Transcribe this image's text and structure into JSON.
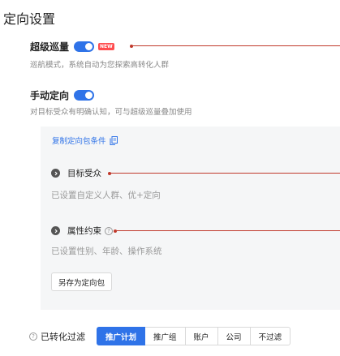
{
  "page": {
    "title": "定向设置"
  },
  "super_cruise": {
    "label": "超级巡量",
    "enabled": true,
    "badge": "NEW",
    "description": "巡航模式，系统自动为您探索高转化人群"
  },
  "manual_targeting": {
    "label": "手动定向",
    "enabled": true,
    "description": "对目标受众有明确认知，可与超级巡量叠加使用"
  },
  "panel": {
    "copy_link": "复制定向包条件",
    "audience": {
      "title": "目标受众",
      "summary": "已设置自定义人群、优+定向"
    },
    "attributes": {
      "title": "属性约束",
      "summary": "已设置性别、年龄、操作系统"
    },
    "save_button": "另存为定向包"
  },
  "conversion_filter": {
    "label": "已转化过滤",
    "options": [
      "推广计划",
      "推广组",
      "账户",
      "公司",
      "不过滤"
    ],
    "selected": "推广计划"
  },
  "colors": {
    "accent": "#2f73e8",
    "badge": "#ff4d4f",
    "annotation": "#c0392b"
  }
}
